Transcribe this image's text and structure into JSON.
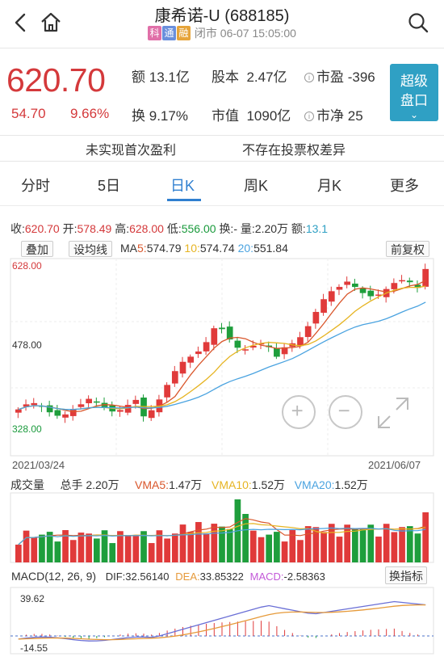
{
  "header": {
    "title": "康希诺-U (688185)",
    "badges": [
      {
        "text": "科",
        "color": "#e06fa8"
      },
      {
        "text": "通",
        "color": "#6a8fdc"
      },
      {
        "text": "融",
        "color": "#e6a43a"
      }
    ],
    "status": "闭市 06-07 15:05:00"
  },
  "quote": {
    "price": "620.70",
    "change": "54.70",
    "change_pct": "9.66%",
    "amount_label": "额",
    "amount": "13.1亿",
    "share_label": "股本",
    "share": "2.47亿",
    "pe_label": "市盈",
    "pe": "-396",
    "turnover_label": "换",
    "turnover": "9.17%",
    "mcap_label": "市值",
    "mcap": "1090亿",
    "pb_label": "市净",
    "pb": "25",
    "level2_line1": "超级",
    "level2_line2": "盘口",
    "level2_arrow": "⌄"
  },
  "notes": {
    "left": "未实现首次盈利",
    "right": "不存在投票权差异"
  },
  "tabs": [
    "分时",
    "5日",
    "日K",
    "周K",
    "月K",
    "更多"
  ],
  "active_tab": "日K",
  "dataline": {
    "close_label": "收:",
    "close": "620.70",
    "open_label": "开:",
    "open": "578.49",
    "high_label": "高:",
    "high": "628.00",
    "low_label": "低:",
    "low": "556.00",
    "turn_label": "换:",
    "turn": "-",
    "vol_label": "量:",
    "vol": "2.20万",
    "amt_label": "额:",
    "amt": "13.1"
  },
  "controls": {
    "overlay": "叠加",
    "set_ma": "设均线",
    "adjust": "前复权",
    "switch_indicator": "换指标"
  },
  "ma": {
    "prefix": "MA",
    "ma5_label": "5:",
    "ma5": "574.79",
    "ma10_label": "10:",
    "ma10": "574.74",
    "ma20_label": "20:",
    "ma20": "551.84"
  },
  "price_axis": {
    "top": "628.00",
    "mid": "478.00",
    "bottom": "328.00"
  },
  "dates": {
    "start": "2021/03/24",
    "end": "2021/06/07"
  },
  "volume": {
    "title": "成交量",
    "total_label": "总手",
    "total": "2.20万",
    "vma5_label": "VMA5:",
    "vma5": "1.47万",
    "vma10_label": "VMA10:",
    "vma10": "1.52万",
    "vma20_label": "VMA20:",
    "vma20": "1.52万"
  },
  "macd": {
    "title": "MACD(12, 26, 9)",
    "dif_label": "DIF:",
    "dif": "32.56140",
    "dea_label": "DEA:",
    "dea": "33.85322",
    "macd_label": "MACD:",
    "macd": "-2.58363",
    "axis_top": "39.62",
    "axis_bottom": "-14.55"
  },
  "colors": {
    "up": "#e03a3a",
    "down": "#1e9e3c",
    "ma5": "#d9562b",
    "ma10": "#e6b422",
    "ma20": "#4aa3e0",
    "dea": "#e69a3a",
    "dif": "#6a6fd6",
    "macd_label": "#c35ad9",
    "level2": "#2fa0c4",
    "accent": "#2f7fd0"
  },
  "icons": [
    "back-icon",
    "home-icon",
    "search-icon",
    "zoom-in-icon",
    "zoom-out-icon",
    "expand-icon",
    "info-icon"
  ]
}
